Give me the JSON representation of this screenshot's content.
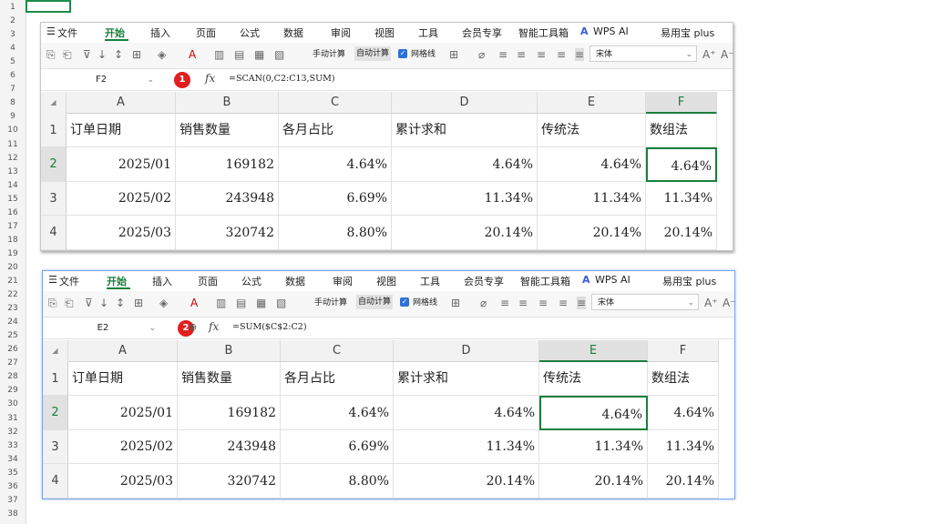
{
  "outer_sheet": {
    "row_numbers": [
      "1",
      "2",
      "3",
      "4",
      "5",
      "6",
      "7",
      "8",
      "9",
      "10",
      "11",
      "12",
      "13",
      "14",
      "15",
      "16",
      "17",
      "18",
      "19",
      "20",
      "21",
      "22",
      "23",
      "24",
      "25",
      "26",
      "27",
      "28",
      "29",
      "30",
      "31",
      "32",
      "33",
      "34",
      "35",
      "36",
      "37",
      "38"
    ]
  },
  "menu": {
    "file_label": "文件",
    "tabs": [
      "开始",
      "插入",
      "页面",
      "公式",
      "数据",
      "审阅",
      "视图",
      "工具",
      "会员专享",
      "智能工具箱",
      "WPS AI",
      "易用宝 plus"
    ],
    "active_tab": "开始"
  },
  "toolbar": {
    "manual_calc": "手动计算",
    "auto_calc": "自动计算",
    "gridlines": "网格线",
    "font_name": "宋体",
    "text_color_icon": "A"
  },
  "window1": {
    "badge": "1",
    "name_box": "F2",
    "fx_label": "fx",
    "formula": "=SCAN(0,C2:C13,SUM)",
    "selected_col": "F",
    "selected_row": "2"
  },
  "window2": {
    "badge": "2",
    "name_box": "E2",
    "fx_label": "fx",
    "formula": "=SUM($C$2:C2)",
    "selected_col": "E",
    "selected_row": "2"
  },
  "sheet": {
    "columns": [
      "A",
      "B",
      "C",
      "D",
      "E",
      "F"
    ],
    "rows": [
      "1",
      "2",
      "3",
      "4"
    ],
    "headers": [
      "订单日期",
      "销售数量",
      "各月占比",
      "累计求和",
      "传统法",
      "数组法"
    ],
    "data": [
      [
        "2025/01",
        "169182",
        "4.64%",
        "4.64%",
        "4.64%",
        "4.64%"
      ],
      [
        "2025/02",
        "243948",
        "6.69%",
        "11.34%",
        "11.34%",
        "11.34%"
      ],
      [
        "2025/03",
        "320742",
        "8.80%",
        "20.14%",
        "20.14%",
        "20.14%"
      ]
    ]
  },
  "colors": {
    "accent_green": "#1a7f3c",
    "badge_red": "#e01e1e",
    "selection_blue": "#7aa6e8"
  }
}
